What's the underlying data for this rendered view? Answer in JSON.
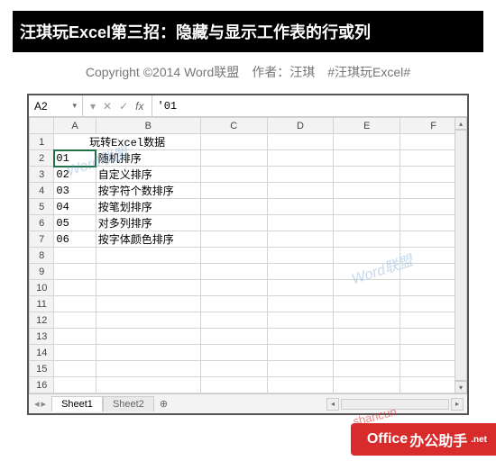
{
  "header": {
    "title": "汪琪玩Excel第三招：隐藏与显示工作表的行或列",
    "copyright": "Copyright ©2014 Word联盟　作者：汪琪　#汪琪玩Excel#"
  },
  "formula_bar": {
    "cell_ref": "A2",
    "dropdown_glyph": "▾",
    "btn_down": "▾",
    "btn_cancel": "✕",
    "btn_confirm": "✓",
    "btn_fx": "fx",
    "value": "'01"
  },
  "columns": [
    "A",
    "B",
    "C",
    "D",
    "E",
    "F"
  ],
  "rows_count": 16,
  "cells": {
    "r1_merged": "玩转Excel数据",
    "r2": {
      "A": "01",
      "B": "随机排序"
    },
    "r3": {
      "A": "02",
      "B": "自定义排序"
    },
    "r4": {
      "A": "03",
      "B": "按字符个数排序"
    },
    "r5": {
      "A": "04",
      "B": "按笔划排序"
    },
    "r6": {
      "A": "05",
      "B": "对多列排序"
    },
    "r7": {
      "A": "06",
      "B": "按字体颜色排序"
    }
  },
  "tabs": {
    "nav_prev": "◂",
    "nav_next": "▸",
    "sheets": [
      "Sheet1",
      "Sheet2"
    ],
    "add": "⊕",
    "active_index": 0
  },
  "scroll": {
    "left": "◂",
    "right": "▸",
    "up": "▴",
    "down": "▾"
  },
  "watermarks": {
    "wm1": "Word联盟",
    "wm2": "Word联盟",
    "wm_red": "shancun"
  },
  "badge": {
    "brand": "Office",
    "cn": "办公助手",
    "sub": ".net"
  }
}
